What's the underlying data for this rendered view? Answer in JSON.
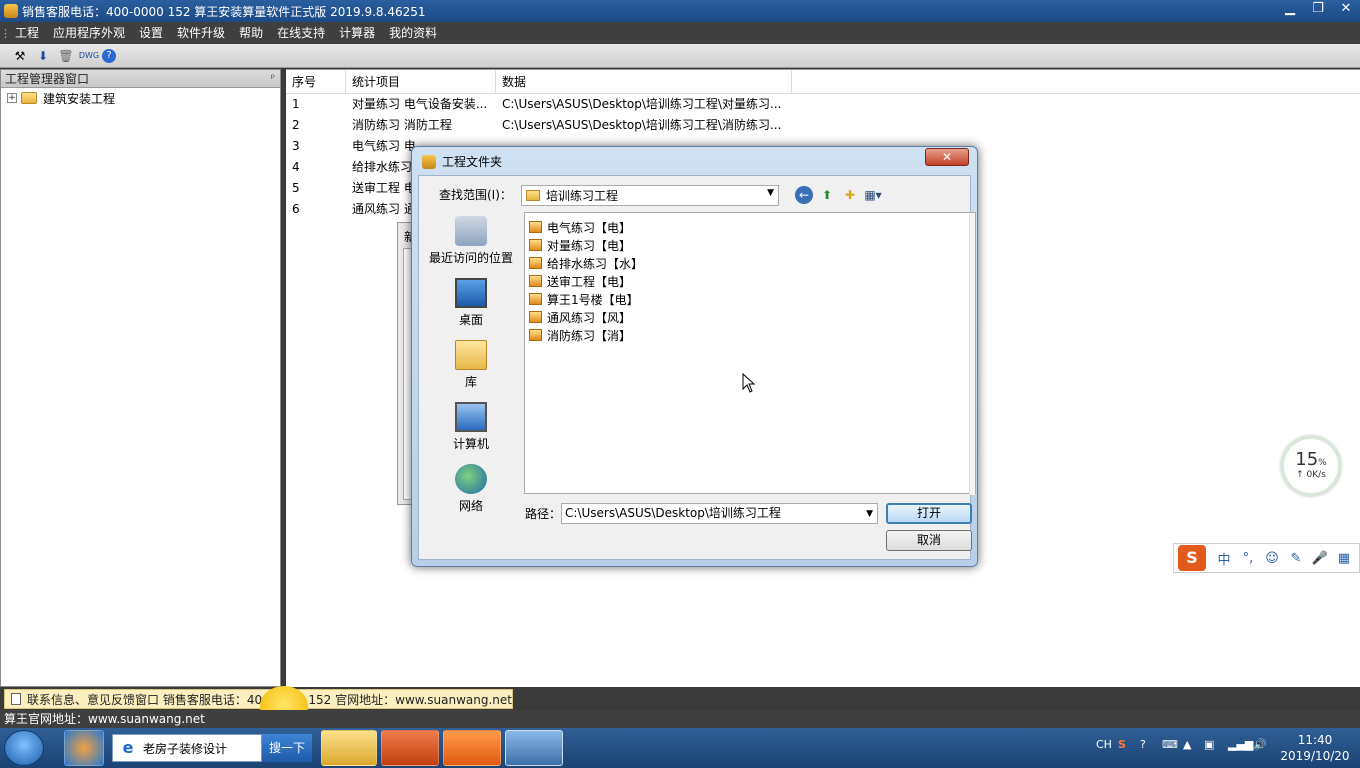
{
  "window": {
    "title": "销售客服电话：400-0000 152   算王安装算量软件正式版 2019.9.8.46251",
    "minimize": "▁",
    "restore": "❐",
    "close": "✕"
  },
  "menubar": {
    "grip": "⋮",
    "items": [
      "工程",
      "应用程序外观",
      "设置",
      "软件升级",
      "帮助",
      "在线支持",
      "计算器",
      "我的资料"
    ]
  },
  "toolbar": {
    "icons": [
      "tools-icon",
      "download-icon",
      "delete-icon",
      "dwg-icon",
      "help-icon"
    ]
  },
  "left_panel": {
    "title": "工程管理器窗口",
    "pin": "ᵖ",
    "tree": [
      {
        "expander": "+",
        "label": "建筑安装工程"
      }
    ]
  },
  "grid": {
    "headers": [
      "序号",
      "统计项目",
      "数据"
    ],
    "rows": [
      [
        "1",
        "对量练习 电气设备安装...",
        "C:\\Users\\ASUS\\Desktop\\培训练习工程\\对量练习..."
      ],
      [
        "2",
        "消防练习 消防工程",
        "C:\\Users\\ASUS\\Desktop\\培训练习工程\\消防练习..."
      ],
      [
        "3",
        "电气练习 电",
        ""
      ],
      [
        "4",
        "给排水练习",
        ""
      ],
      [
        "5",
        "送审工程 电",
        ""
      ],
      [
        "6",
        "通风练习 通",
        ""
      ]
    ]
  },
  "background_window": {
    "title_fragment": "新"
  },
  "dialog": {
    "title": "工程文件夹",
    "close_label": "✕",
    "lookin_label": "查找范围(I)：",
    "lookin_value": "培训练习工程",
    "places": [
      "最近访问的位置",
      "桌面",
      "库",
      "计算机",
      "网络"
    ],
    "files": [
      "电气练习【电】",
      "对量练习【电】",
      "给排水练习【水】",
      "送审工程【电】",
      "算王1号楼【电】",
      "通风练习【风】",
      "消防练习【消】"
    ],
    "path_label": "路径：",
    "path_value": "C:\\Users\\ASUS\\Desktop\\培训练习工程",
    "open_button": "打开",
    "cancel_button": "取消"
  },
  "speed_widget": {
    "percent": "15",
    "percent_unit": "%",
    "rate": "↑ 0K/s"
  },
  "ime_bar": {
    "logo": "S",
    "buttons": [
      "中",
      "°,",
      "☺",
      "✎",
      "🎤",
      "▦"
    ]
  },
  "notice": {
    "text": "联系信息、意见反馈窗口  销售客服电话：400-0000 152   官网地址：www.suanwang.net"
  },
  "statusbar": {
    "text": "算王官网地址：www.suanwang.net"
  },
  "taskbar": {
    "search_text": "老房子装修设计",
    "search_button": "搜一下",
    "tray_lang": "CH",
    "time": "11:40",
    "date": "2019/10/20"
  }
}
